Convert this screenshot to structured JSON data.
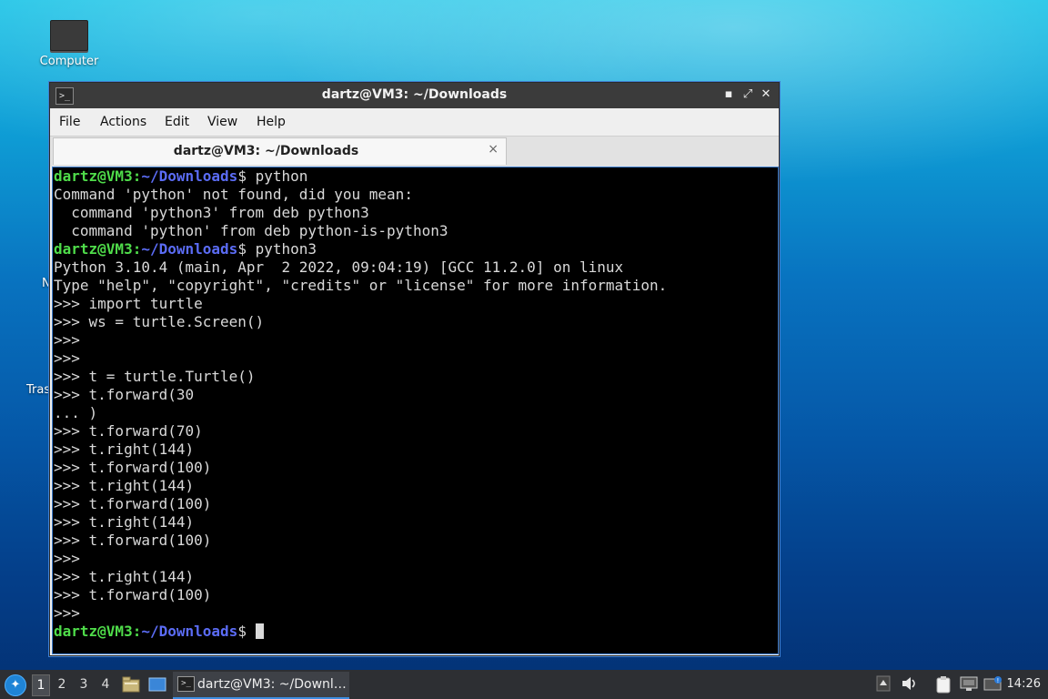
{
  "desktop": {
    "computer_label": "Computer",
    "partial_label_n": "N",
    "partial_label_trash": "Tras"
  },
  "window": {
    "title": "dartz@VM3: ~/Downloads",
    "menu": [
      "File",
      "Actions",
      "Edit",
      "View",
      "Help"
    ],
    "tab_title": "dartz@VM3: ~/Downloads",
    "tab_close": "×",
    "min_glyph": "▪",
    "max_glyph": "⤢",
    "close_glyph": "✕"
  },
  "terminal": {
    "prompt_user": "dartz@VM3",
    "prompt_path": "~/Downloads",
    "lines": [
      {
        "type": "prompt",
        "cmd": " python"
      },
      {
        "type": "out",
        "text": "Command 'python' not found, did you mean:"
      },
      {
        "type": "out",
        "text": "  command 'python3' from deb python3"
      },
      {
        "type": "out",
        "text": "  command 'python' from deb python-is-python3"
      },
      {
        "type": "prompt",
        "cmd": " python3"
      },
      {
        "type": "out",
        "text": "Python 3.10.4 (main, Apr  2 2022, 09:04:19) [GCC 11.2.0] on linux"
      },
      {
        "type": "out",
        "text": "Type \"help\", \"copyright\", \"credits\" or \"license\" for more information."
      },
      {
        "type": "out",
        "text": ">>> import turtle"
      },
      {
        "type": "out",
        "text": ">>> ws = turtle.Screen()"
      },
      {
        "type": "out",
        "text": ">>>"
      },
      {
        "type": "out",
        "text": ">>>"
      },
      {
        "type": "out",
        "text": ">>> t = turtle.Turtle()"
      },
      {
        "type": "out",
        "text": ">>> t.forward(30"
      },
      {
        "type": "out",
        "text": "... )"
      },
      {
        "type": "out",
        "text": ">>> t.forward(70)"
      },
      {
        "type": "out",
        "text": ">>> t.right(144)"
      },
      {
        "type": "out",
        "text": ">>> t.forward(100)"
      },
      {
        "type": "out",
        "text": ">>> t.right(144)"
      },
      {
        "type": "out",
        "text": ">>> t.forward(100)"
      },
      {
        "type": "out",
        "text": ">>> t.right(144)"
      },
      {
        "type": "out",
        "text": ">>> t.forward(100)"
      },
      {
        "type": "out",
        "text": ">>>"
      },
      {
        "type": "out",
        "text": ">>> t.right(144)"
      },
      {
        "type": "out",
        "text": ">>> t.forward(100)"
      },
      {
        "type": "out",
        "text": ">>>"
      },
      {
        "type": "prompt",
        "cmd": " ",
        "cursor": true
      }
    ]
  },
  "taskbar": {
    "workspaces": [
      "1",
      "2",
      "3",
      "4"
    ],
    "active_workspace": "1",
    "task_label": "dartz@VM3: ~/Downl…",
    "clock": "14:26"
  },
  "colors": {
    "prompt_user": "#4fdc4a",
    "prompt_path": "#5b6cf5",
    "terminal_bg": "#000000",
    "terminal_fg": "#d9d9d9"
  }
}
